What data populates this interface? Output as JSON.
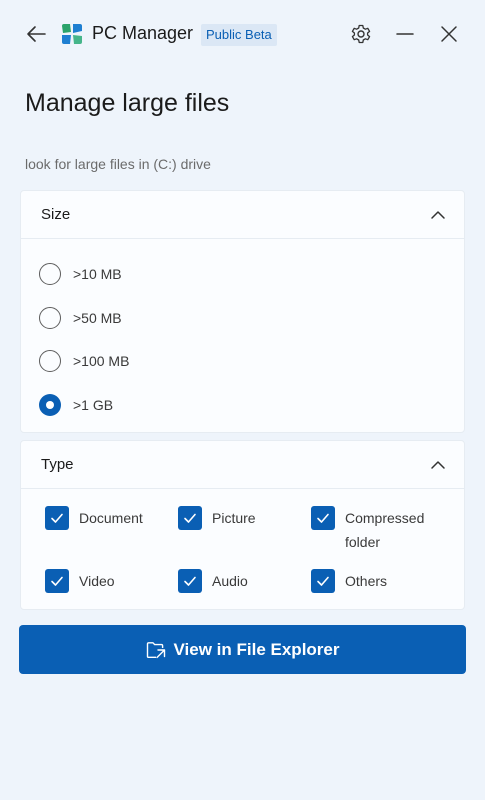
{
  "app": {
    "title": "PC Manager",
    "badge": "Public Beta"
  },
  "page": {
    "title": "Manage large files",
    "subtitle": "look for large files in (C:) drive"
  },
  "size_section": {
    "label": "Size",
    "expanded": true,
    "options": [
      {
        "label": ">10 MB",
        "checked": false
      },
      {
        "label": ">50 MB",
        "checked": false
      },
      {
        "label": ">100 MB",
        "checked": false
      },
      {
        "label": ">1 GB",
        "checked": true
      }
    ]
  },
  "type_section": {
    "label": "Type",
    "expanded": true,
    "options": [
      {
        "label": "Document",
        "checked": true
      },
      {
        "label": "Picture",
        "checked": true
      },
      {
        "label": "Compressed folder",
        "checked": true
      },
      {
        "label": "Video",
        "checked": true
      },
      {
        "label": "Audio",
        "checked": true
      },
      {
        "label": "Others",
        "checked": true
      }
    ]
  },
  "action": {
    "label": "View in File Explorer",
    "icon": "folder-open-icon"
  },
  "colors": {
    "accent": "#0a5fb4",
    "background": "#eef4fb",
    "card": "#fbfdff",
    "badge_bg": "#dbe7f5"
  }
}
